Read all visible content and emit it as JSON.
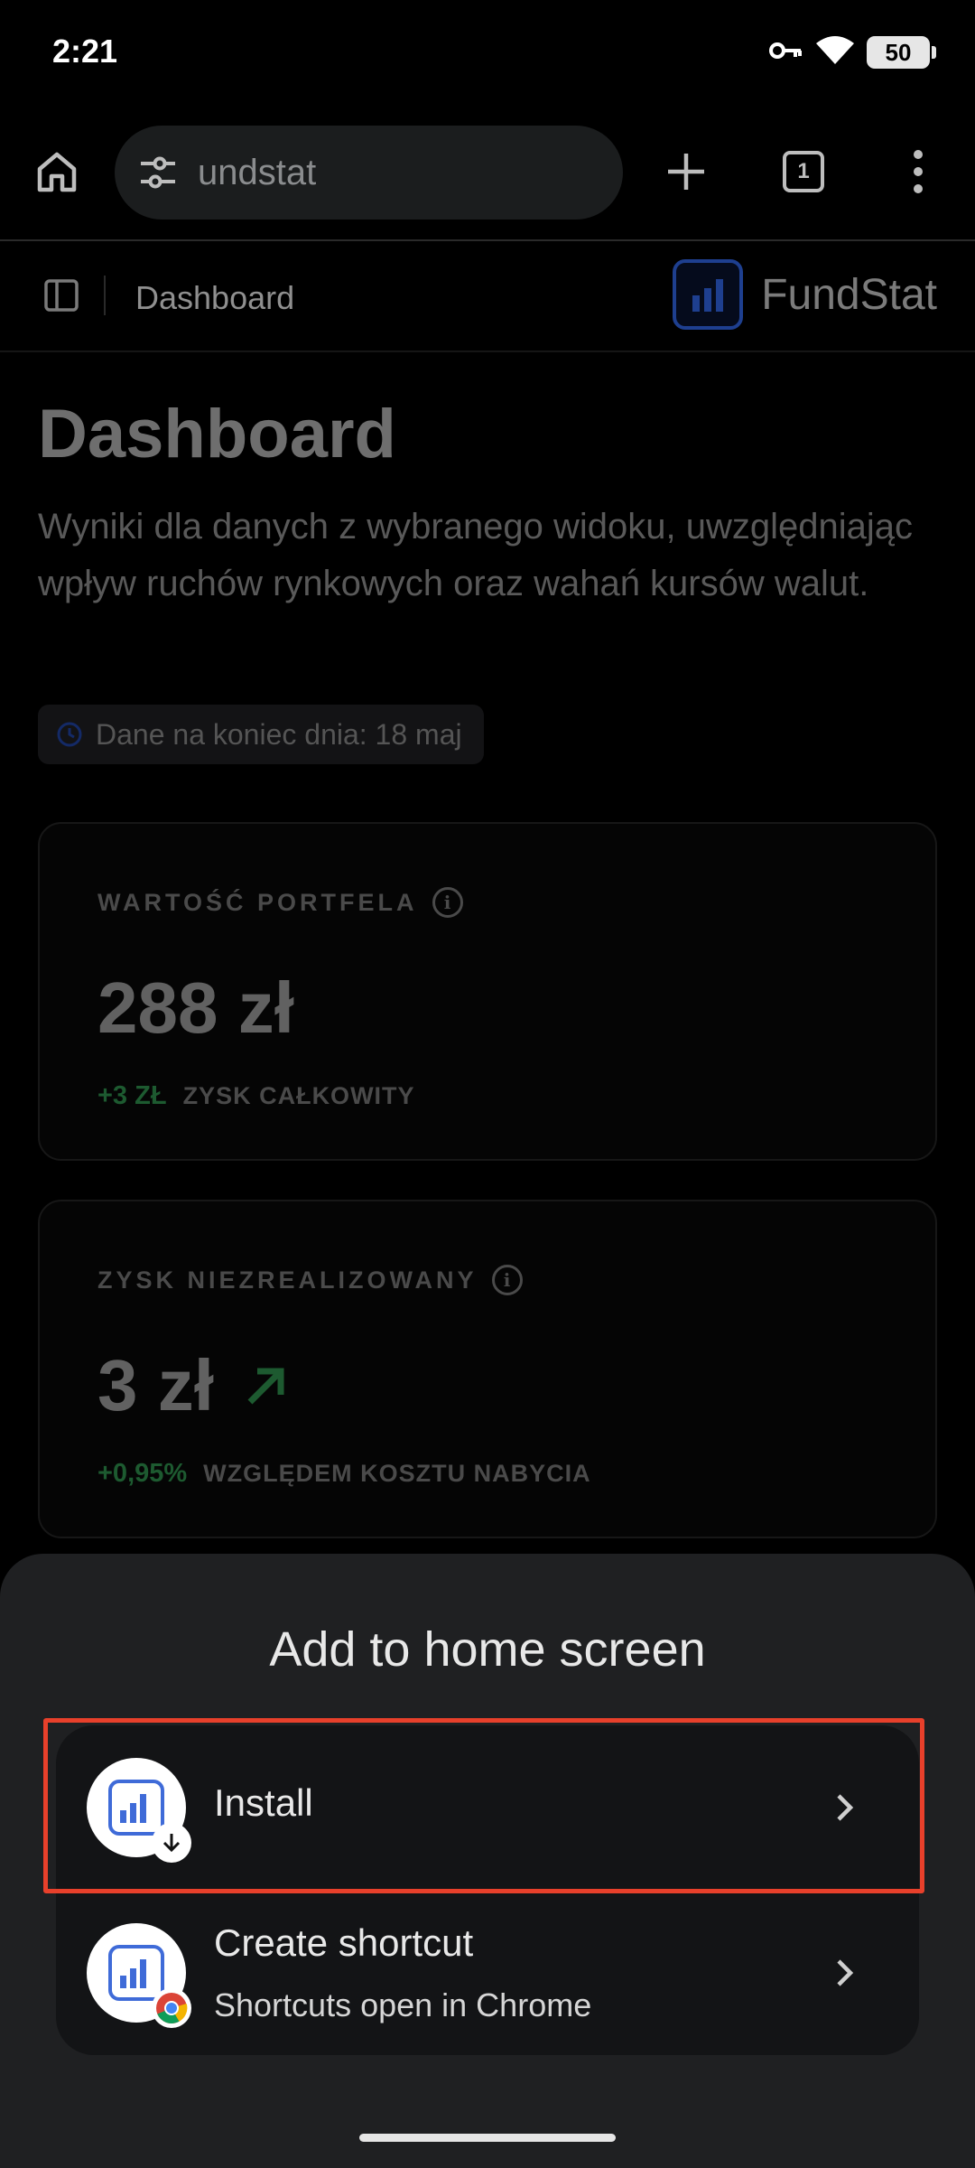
{
  "status_bar": {
    "time": "2:21",
    "battery": "50",
    "icons": [
      "vpn-key-icon",
      "wifi-icon",
      "battery-icon"
    ]
  },
  "browser": {
    "url_text": "undstat",
    "tab_count": "1",
    "icons": [
      "home-icon",
      "tune-icon",
      "plus-icon",
      "tabs-icon",
      "more-vert-icon"
    ]
  },
  "page": {
    "breadcrumb": "Dashboard",
    "brand_name": "FundStat",
    "title": "Dashboard",
    "description": "Wyniki dla danych z wybranego widoku, uwzględniając wpływ ruchów rynkowych oraz wahań kursów walut.",
    "date_chip": "Dane na koniec dnia: 18 maj",
    "cards": [
      {
        "label": "WARTOŚĆ PORTFELA",
        "value": "288 zł",
        "change": "+3 ZŁ",
        "foot_label": "ZYSK CAŁKOWITY"
      },
      {
        "label": "ZYSK NIEZREALIZOWANY",
        "value": "3 zł",
        "change": "+0,95%",
        "foot_label": "WZGLĘDEM KOSZTU NABYCIA"
      }
    ],
    "colors": {
      "gain": "#1d5a30",
      "brand": "#1e3f8f"
    }
  },
  "sheet": {
    "title": "Add to home screen",
    "options": [
      {
        "label": "Install",
        "badge_icon": "download-icon"
      },
      {
        "label": "Create shortcut",
        "subtitle": "Shortcuts open in Chrome",
        "badge_icon": "chrome-icon"
      }
    ],
    "highlight_color": "#e8402b"
  }
}
